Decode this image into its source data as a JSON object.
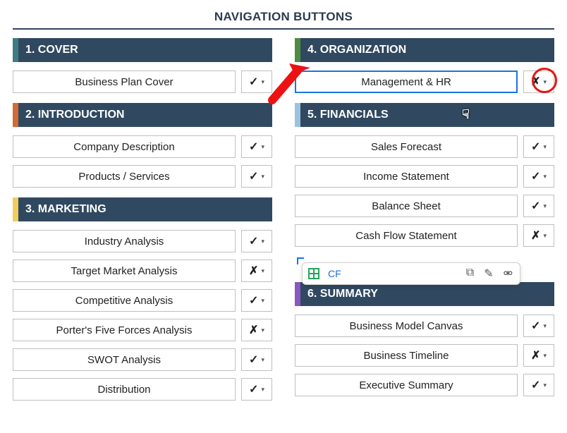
{
  "title": "NAVIGATION BUTTONS",
  "marks": {
    "check": "✓",
    "cross": "✗",
    "caret": "▾"
  },
  "popup": {
    "label": "CF"
  },
  "sections": {
    "s1": {
      "header": "1. COVER"
    },
    "s2": {
      "header": "2. INTRODUCTION"
    },
    "s3": {
      "header": "3. MARKETING"
    },
    "s4": {
      "header": "4. ORGANIZATION"
    },
    "s5": {
      "header": "5. FINANCIALS"
    },
    "s6": {
      "header": "6. SUMMARY"
    }
  },
  "left": {
    "r1": {
      "label": "Business Plan Cover",
      "mark": "✓"
    },
    "r2": {
      "label": "Company Description",
      "mark": "✓"
    },
    "r3": {
      "label": "Products / Services",
      "mark": "✓"
    },
    "r4": {
      "label": "Industry Analysis",
      "mark": "✓"
    },
    "r5": {
      "label": "Target Market Analysis",
      "mark": "✗"
    },
    "r6": {
      "label": "Competitive Analysis",
      "mark": "✓"
    },
    "r7": {
      "label": "Porter's Five Forces Analysis",
      "mark": "✗"
    },
    "r8": {
      "label": "SWOT Analysis",
      "mark": "✓"
    },
    "r9": {
      "label": "Distribution",
      "mark": "✓"
    }
  },
  "right": {
    "r1": {
      "label": "Management & HR",
      "mark": "✗"
    },
    "r2": {
      "label": "Sales Forecast",
      "mark": "✓"
    },
    "r3": {
      "label": "Income Statement",
      "mark": "✓"
    },
    "r4": {
      "label": "Balance Sheet",
      "mark": "✓"
    },
    "r5": {
      "label": "Cash Flow Statement",
      "mark": "✗"
    },
    "r6": {
      "label": "Business Model Canvas",
      "mark": "✓"
    },
    "r7": {
      "label": "Business Timeline",
      "mark": "✗"
    },
    "r8": {
      "label": "Executive Summary",
      "mark": "✓"
    }
  }
}
